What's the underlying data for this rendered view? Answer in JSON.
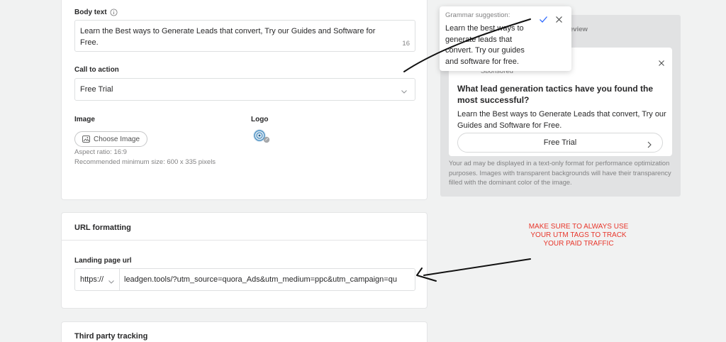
{
  "body_text": {
    "label": "Body text",
    "value": "Learn the Best ways to Generate Leads that convert, Try our Guides and Software for Free.",
    "char_count": "16"
  },
  "cta": {
    "label": "Call to action",
    "value": "Free Trial"
  },
  "image": {
    "label": "Image",
    "button": "Choose Image",
    "aspect": "Aspect ratio: 16:9",
    "min_size": "Recommended minimum size: 600 x 335 pixels"
  },
  "logo": {
    "label": "Logo"
  },
  "url_formatting": {
    "title": "URL formatting",
    "landing_label": "Landing page url",
    "protocol": "https://",
    "url_value": "leadgen.tools/?utm_source=quora_Ads&utm_medium=ppc&utm_campaign=qu"
  },
  "third_party": {
    "title": "Third party tracking"
  },
  "preview": {
    "header_suffix": "eview",
    "sponsored": "Sponsored",
    "ad_title": "What lead generation tactics have you found the most successful?",
    "ad_body": "Learn the Best ways to Generate Leads that convert, Try our Guides and Software for Free.",
    "ad_button": "Free Trial",
    "note": "Your ad may be displayed in a text-only format for performance optimization purposes. Images with transparent backgrounds will have their transparency filled with the dominant color of the image."
  },
  "grammar": {
    "title": "Grammar suggestion:",
    "suggestion": "Learn the best ways to generate leads that convert. Try our guides and software for free."
  },
  "annotation": {
    "text": "MAKE SURE TO ALWAYS USE YOUR UTM TAGS TO TRACK YOUR PAID TRAFFIC"
  },
  "colors": {
    "annotation_red": "#e8372c",
    "accept_blue": "#2e69ff",
    "page_bg": "#f1f2f2"
  }
}
